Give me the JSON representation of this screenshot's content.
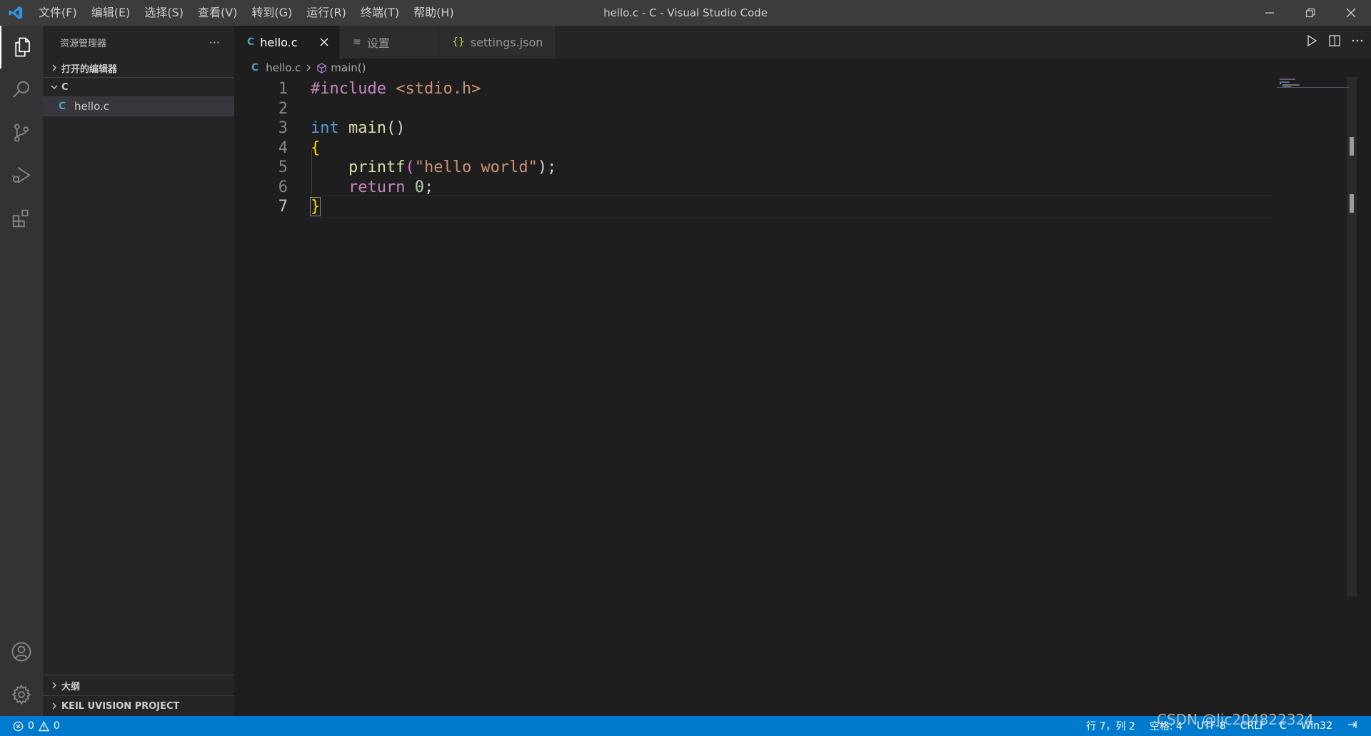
{
  "window": {
    "title": "hello.c - C - Visual Studio Code"
  },
  "menu": [
    "文件(F)",
    "编辑(E)",
    "选择(S)",
    "查看(V)",
    "转到(G)",
    "运行(R)",
    "终端(T)",
    "帮助(H)"
  ],
  "sidebar": {
    "title": "资源管理器",
    "more": "···",
    "open_editors": "打开的编辑器",
    "folder": "C",
    "files": [
      {
        "glyph": "C",
        "name": "hello.c"
      }
    ],
    "outline": "大纲",
    "keil": "KEIL UVISION PROJECT"
  },
  "tabs": [
    {
      "icon": "C",
      "label": "hello.c"
    },
    {
      "icon": "≡",
      "label": "设置"
    },
    {
      "icon": "{}",
      "label": "settings.json"
    }
  ],
  "breadcrumb": {
    "file_glyph": "C",
    "file": "hello.c",
    "symbol": "main()"
  },
  "code": {
    "line_numbers": [
      "1",
      "2",
      "3",
      "4",
      "5",
      "6",
      "7"
    ],
    "l1_directive": "#include",
    "l1_header": "<stdio.h>",
    "l3_type": "int",
    "l3_func": "main",
    "l3_parens": "()",
    "l4": "{",
    "l5_indent": "    ",
    "l5_func": "printf",
    "l5_open": "(",
    "l5_str": "\"hello world\"",
    "l5_close": ");",
    "l6_indent": "    ",
    "l6_kw": "return",
    "l6_num": "0",
    "l6_semi": ";",
    "l7": "}"
  },
  "status": {
    "errors": "0",
    "warnings": "0",
    "position": "行 7，列 2",
    "spaces": "空格: 4",
    "encoding": "UTF-8",
    "eol": "CRLF",
    "language": "C",
    "platform": "Win32"
  },
  "watermark": "CSDN @ljc204822324",
  "colors": {
    "accent": "#007acc",
    "keyword": "#569cd6",
    "control": "#c586c0",
    "function": "#dcdcaa",
    "string": "#ce9178",
    "number": "#b5cea8",
    "brace": "#ffd700"
  }
}
